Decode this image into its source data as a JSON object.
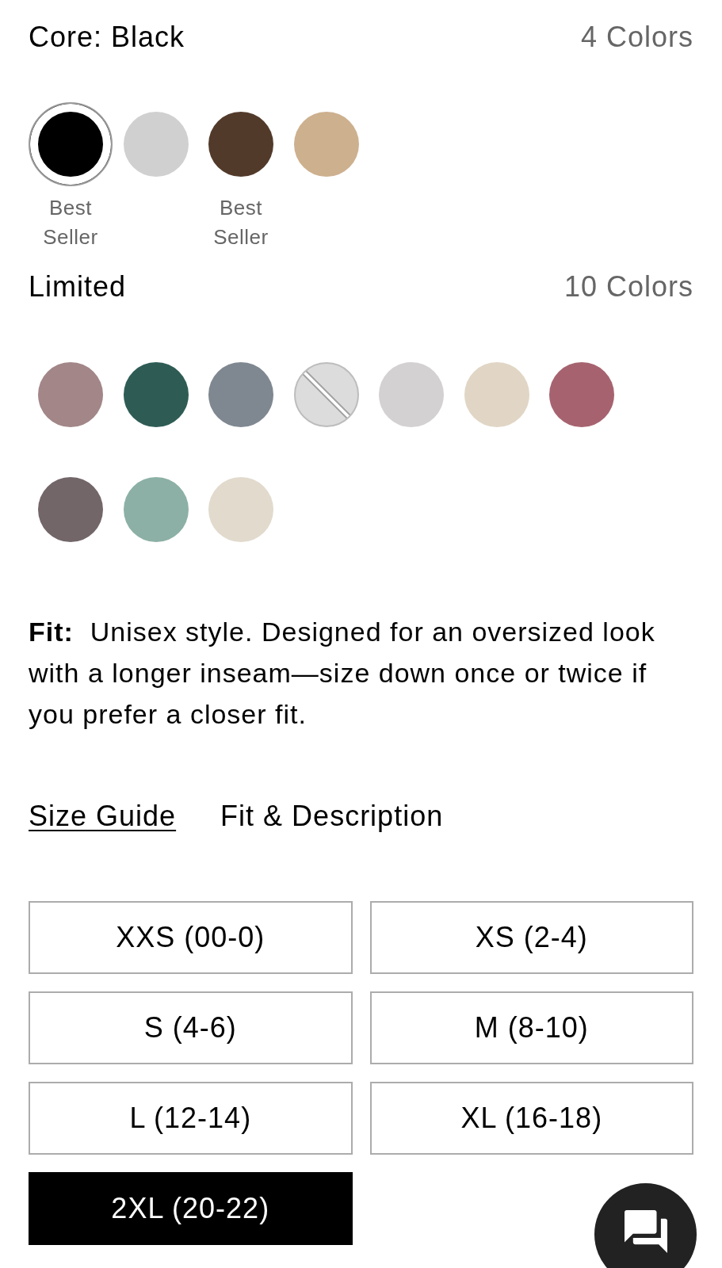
{
  "core": {
    "title": "Core: Black",
    "count": "4 Colors",
    "swatches": [
      {
        "color": "#000000",
        "selected": true,
        "crossed_out": false,
        "caption": "Best Seller"
      },
      {
        "color": "#d0d0d0",
        "selected": false,
        "crossed_out": false
      },
      {
        "color": "#523a2b",
        "selected": false,
        "crossed_out": false,
        "caption": "Best Seller"
      },
      {
        "color": "#cdb08e",
        "selected": false,
        "crossed_out": false
      }
    ]
  },
  "limited": {
    "title": "Limited",
    "count": "10 Colors",
    "swatches": [
      {
        "color": "#a28688",
        "selected": false,
        "crossed_out": false
      },
      {
        "color": "#2e5c55",
        "selected": false,
        "crossed_out": false
      },
      {
        "color": "#7f8891",
        "selected": false,
        "crossed_out": false
      },
      {
        "color": "#dcdcdc",
        "selected": false,
        "crossed_out": true
      },
      {
        "color": "#d4d1d2",
        "selected": false,
        "crossed_out": false
      },
      {
        "color": "#e1d6c5",
        "selected": false,
        "crossed_out": false
      },
      {
        "color": "#a6636f",
        "selected": false,
        "crossed_out": false
      },
      {
        "color": "#726669",
        "selected": false,
        "crossed_out": false
      },
      {
        "color": "#8cb0a5",
        "selected": false,
        "crossed_out": false
      },
      {
        "color": "#e1dacd",
        "selected": false,
        "crossed_out": false
      }
    ]
  },
  "fit": "**Fit:**  Unisex style. Designed for an oversized look with a longer inseam—size down once or twice if you prefer a closer fit.",
  "links": [
    {
      "label": "Size Guide",
      "underlined": true
    },
    {
      "label": "Fit & Description",
      "underlined": false
    }
  ],
  "sizes": [
    {
      "label": "XXS (00-0)",
      "selected": false
    },
    {
      "label": "XS (2-4)",
      "selected": false
    },
    {
      "label": "S (4-6)",
      "selected": false
    },
    {
      "label": "M (8-10)",
      "selected": false
    },
    {
      "label": "L (12-14)",
      "selected": false
    },
    {
      "label": "XL (16-18)",
      "selected": false
    },
    {
      "label": "2XL (20-22)",
      "selected": true
    }
  ]
}
